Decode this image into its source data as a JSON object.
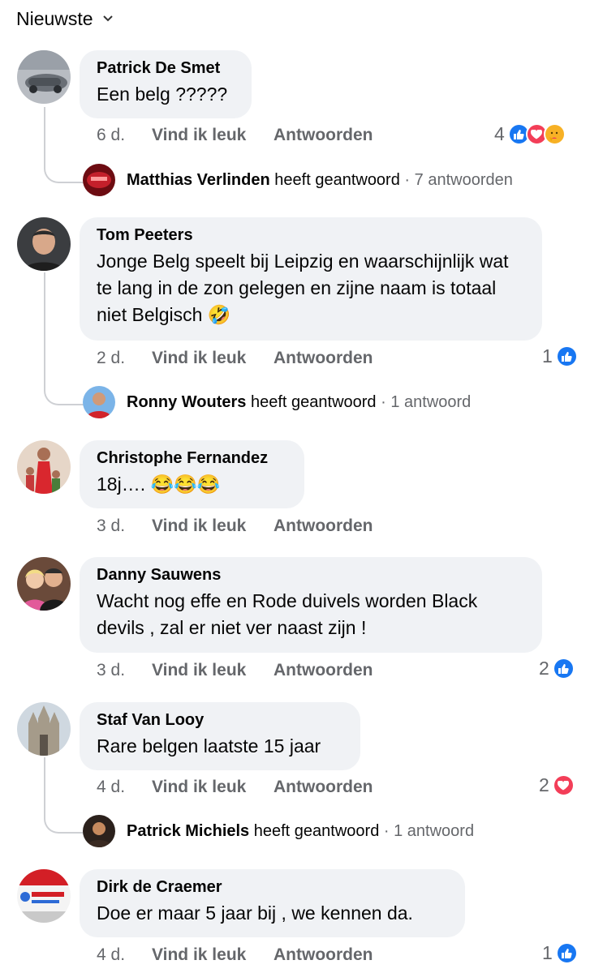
{
  "sort": {
    "label": "Nieuwste"
  },
  "actions": {
    "like": "Vind ik leuk",
    "reply": "Antwoorden"
  },
  "comments": [
    {
      "author": "Patrick De Smet",
      "text": "Een belg ?????",
      "time": "6 d.",
      "reaction_count": "4",
      "reactions": [
        "like-icon",
        "love-icon",
        "care-icon"
      ],
      "reply": {
        "author": "Matthias Verlinden",
        "verb": "heeft geantwoord",
        "dot": "·",
        "count": "7 antwoorden"
      }
    },
    {
      "author": "Tom Peeters",
      "text": "Jonge Belg speelt bij Leipzig en waarschijnlijk wat te lang in de zon gelegen en zijne naam is totaal niet Belgisch 🤣",
      "time": "2 d.",
      "reaction_count": "1",
      "reactions": [
        "like-icon"
      ],
      "reply": {
        "author": "Ronny Wouters",
        "verb": "heeft geantwoord",
        "dot": "·",
        "count": "1 antwoord"
      }
    },
    {
      "author": "Christophe Fernandez",
      "text": "18j…. 😂😂😂",
      "time": "3 d."
    },
    {
      "author": "Danny Sauwens",
      "text": "Wacht nog effe en Rode duivels worden Black devils , zal er niet ver naast zijn !",
      "time": "3 d.",
      "reaction_count": "2",
      "reactions": [
        "like-icon"
      ]
    },
    {
      "author": "Staf Van Looy",
      "text": "Rare belgen laatste 15 jaar",
      "time": "4 d.",
      "reaction_count": "2",
      "reactions": [
        "love-icon"
      ],
      "reply": {
        "author": "Patrick Michiels",
        "verb": "heeft geantwoord",
        "dot": "·",
        "count": "1 antwoord"
      }
    },
    {
      "author": "Dirk de Craemer",
      "text": "Doe er maar 5 jaar bij , we kennen da.",
      "time": "4 d.",
      "reaction_count": "1",
      "reactions": [
        "like-icon"
      ]
    }
  ],
  "colors": {
    "bubble": "#f0f2f5",
    "meta": "#65676b",
    "like": "#1877f2",
    "love": "#f33e58",
    "care": "#f7b125"
  }
}
